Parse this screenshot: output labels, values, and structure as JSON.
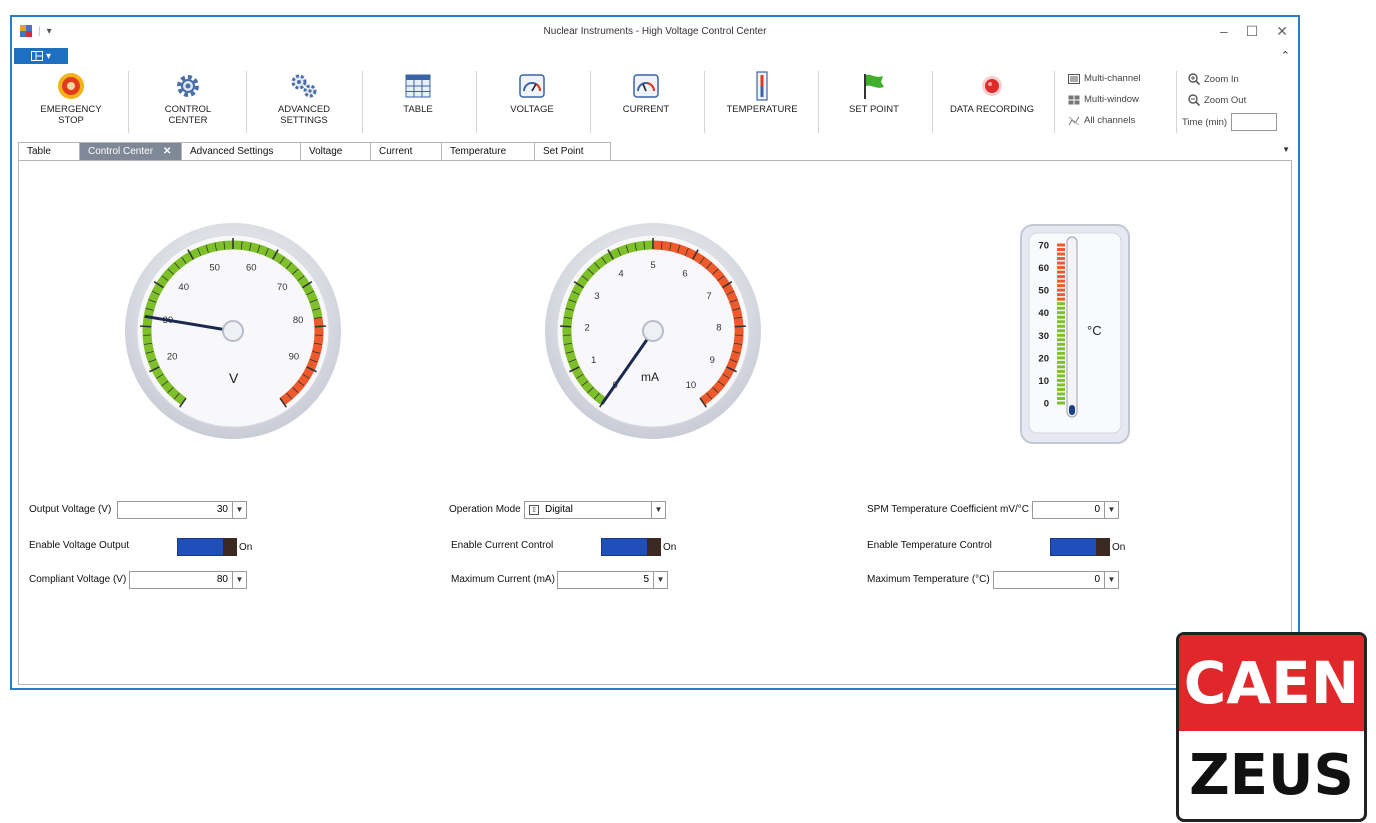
{
  "window": {
    "title": "Nuclear Instruments - High Voltage Control Center",
    "quick_access": "▾",
    "minimize": "–",
    "maximize": "☐",
    "close": "✕",
    "collapse": "⌃"
  },
  "ribbon": {
    "buttons": [
      {
        "label1": "EMERGENCY",
        "label2": "STOP",
        "icon": "emergency-stop-icon"
      },
      {
        "label1": "CONTROL",
        "label2": "CENTER",
        "icon": "gear-icon"
      },
      {
        "label1": "ADVANCED",
        "label2": "SETTINGS",
        "icon": "gears-icon"
      },
      {
        "label1": "TABLE",
        "label2": "",
        "icon": "table-icon"
      },
      {
        "label1": "VOLTAGE",
        "label2": "",
        "icon": "voltage-gauge-icon"
      },
      {
        "label1": "CURRENT",
        "label2": "",
        "icon": "current-gauge-icon"
      },
      {
        "label1": "TEMPERATURE",
        "label2": "",
        "icon": "thermometer-icon"
      },
      {
        "label1": "SET POINT",
        "label2": "",
        "icon": "flag-icon"
      },
      {
        "label1": "DATA RECORDING",
        "label2": "",
        "icon": "record-icon"
      }
    ],
    "view": {
      "multi_channel": "Multi-channel",
      "multi_window": "Multi-window",
      "all_channels": "All channels"
    },
    "zoom": {
      "zoom_in": "Zoom In",
      "zoom_out": "Zoom Out",
      "time_label": "Time (min)",
      "time_value": ""
    }
  },
  "tabs": [
    "Table",
    "Control Center",
    "Advanced Settings",
    "Voltage",
    "Current",
    "Temperature",
    "Set Point"
  ],
  "active_tab": "Control Center",
  "voltage_gauge": {
    "unit": "V",
    "value": 30,
    "min": 10,
    "max": 100,
    "ticks": [
      "20",
      "30",
      "40",
      "50",
      "60",
      "70",
      "80",
      "90"
    ],
    "colors": {
      "normal": "#7ec02a",
      "alarm": "#ef5a2c"
    }
  },
  "current_gauge": {
    "unit": "mA",
    "value": 0,
    "min": 0,
    "max": 10,
    "ticks": [
      "0",
      "1",
      "2",
      "3",
      "4",
      "5",
      "6",
      "7",
      "8",
      "9",
      "10"
    ],
    "colors": {
      "normal": "#7ec02a",
      "alarm": "#ef5a2c"
    }
  },
  "thermometer": {
    "unit": "°C",
    "value": 0,
    "ticks": [
      "70",
      "60",
      "50",
      "40",
      "30",
      "20",
      "10",
      "0"
    ],
    "colors": {
      "normal": "#7ec02a",
      "alarm": "#ef5a2c",
      "fluid": "#1b3f86"
    }
  },
  "controls": {
    "output_voltage": {
      "label": "Output Voltage (V)",
      "value": "30"
    },
    "enable_voltage": {
      "label": "Enable Voltage Output",
      "state": "On"
    },
    "compliant_voltage": {
      "label": "Compliant Voltage (V)",
      "value": "80"
    },
    "operation_mode": {
      "label": "Operation Mode",
      "value": "Digital"
    },
    "enable_current": {
      "label": "Enable Current Control",
      "state": "On"
    },
    "max_current": {
      "label": "Maximum Current (mA)",
      "value": "5"
    },
    "spm_coeff": {
      "label": "SPM Temperature Coefficient mV/°C",
      "value": "0"
    },
    "enable_temp": {
      "label": "Enable Temperature Control",
      "state": "On"
    },
    "max_temp": {
      "label": "Maximum Temperature (°C)",
      "value": "0"
    }
  },
  "logo": {
    "top": "CAEN",
    "bottom": "ZEUS",
    "color": "#e0282a"
  }
}
